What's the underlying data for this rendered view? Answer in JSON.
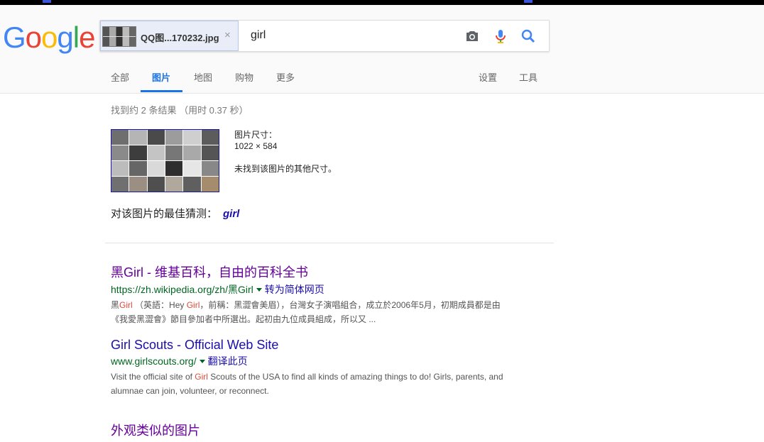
{
  "logo": {
    "letters": [
      "G",
      "o",
      "o",
      "g",
      "l",
      "e"
    ],
    "colors": [
      "#4285f4",
      "#ea4335",
      "#fbbc05",
      "#4285f4",
      "#34a853",
      "#ea4335"
    ]
  },
  "search": {
    "chip_filename": "QQ图...170232.jpg",
    "query": "girl",
    "camera_icon": "camera-icon",
    "mic_icon": "microphone-icon",
    "search_icon": "search-icon"
  },
  "tabs": {
    "all": "全部",
    "images": "图片",
    "maps": "地图",
    "shopping": "购物",
    "more": "更多",
    "settings": "设置",
    "tools": "工具"
  },
  "stats": "找到约 2 条结果 （用时 0.37 秒）",
  "image_info": {
    "size_label": "图片尺寸：",
    "size_value": "1022 × 584",
    "no_other_sizes": "未找到该图片的其他尺寸。"
  },
  "best_guess": {
    "label": "对该图片的最佳猜测：",
    "term": "girl"
  },
  "results": [
    {
      "title_prefix": "黑",
      "title_hl": "Girl",
      "title_suffix": " - 维基百科，自由的百科全书",
      "url": "https://zh.wikipedia.org/zh/黑Girl",
      "translate": "转为简体网页",
      "snip1_a": "黑",
      "snip1_b": "Girl",
      "snip1_c": " （英語：Hey ",
      "snip1_d": "Girl",
      "snip1_e": "，前稱：黑澀會美眉），台灣女子演唱組合，成立於2006年5月，初期成員都是由",
      "snip2": "《我愛黑澀會》節目參加者中所選出。起初由九位成員組成，所以又 ..."
    },
    {
      "title": "Girl Scouts - Official Web Site",
      "url": "www.girlscouts.org/",
      "translate": "翻译此页",
      "snip1_a": "Visit the official site of ",
      "snip1_b": "Girl",
      "snip1_c": " Scouts of the USA to find all kinds of amazing things to do! Girls, parents, and",
      "snip2": "alumnae can join, volunteer, or reconnect."
    }
  ],
  "similar_images": "外观类似的图片",
  "colors": {
    "accent": "#1a73e8",
    "link": "#1a0dab",
    "visited": "#660099",
    "url_green": "#006621",
    "highlight": "#dd4b39"
  }
}
